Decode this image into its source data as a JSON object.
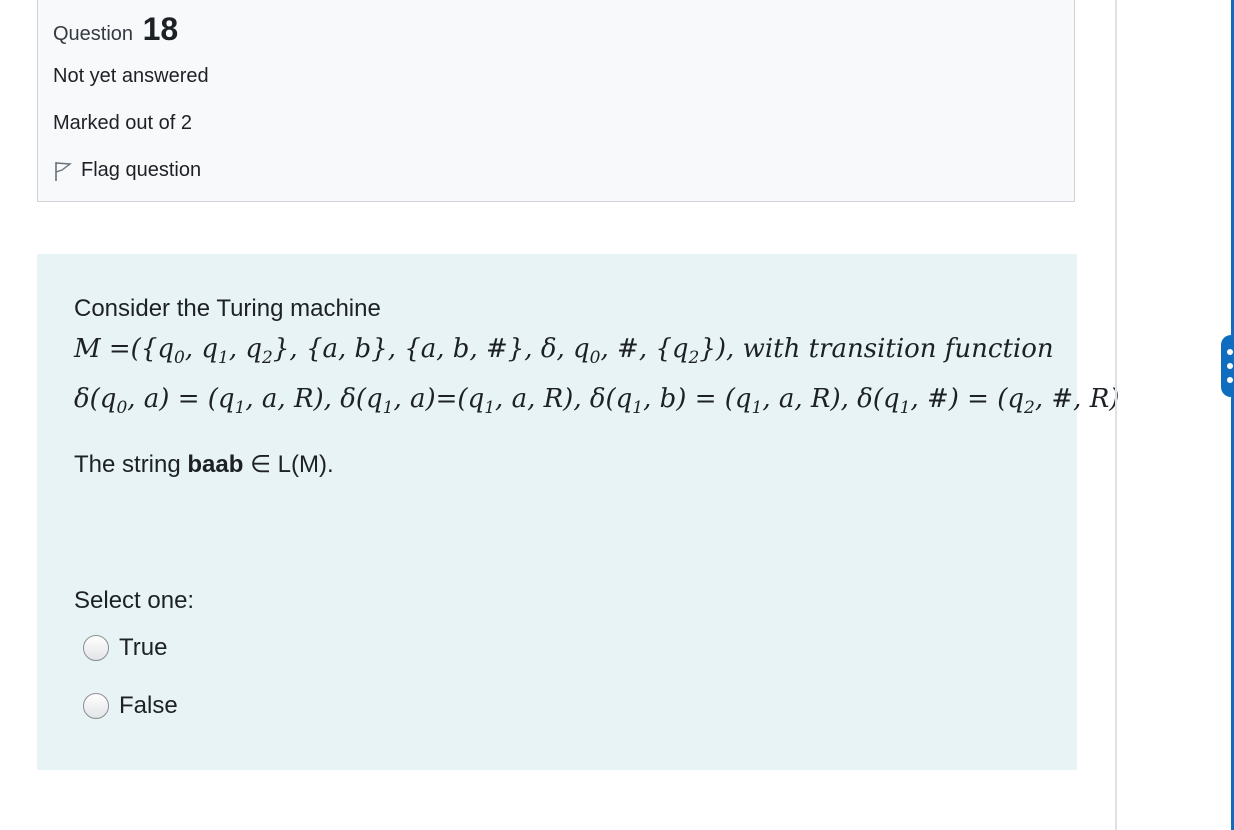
{
  "question_info": {
    "label": "Question",
    "number": "18",
    "state": "Not yet answered",
    "grade": "Marked out of 2",
    "flag_label": "Flag question"
  },
  "question": {
    "intro": "Consider the Turing machine",
    "definition": "M =({q0, q1, q2}, {a, b}, {a, b, #}, δ, q0, #, {q2}), with transition function",
    "transitions": "δ(q0, a) = (q1, a, R), δ(q1, a)=(q1, a, R), δ(q1, b) = (q1, a, R), δ(q1, #) = (q2, #, R)",
    "statement_prefix": "The string",
    "statement_string": "baab",
    "statement_suffix": "∈ L(M).",
    "prompt": "Select one:",
    "options": [
      {
        "label": "True",
        "selected": false
      },
      {
        "label": "False",
        "selected": false
      }
    ]
  },
  "colors": {
    "info_bg": "#f8f9fa",
    "content_bg": "#e7f3f5",
    "accent": "#0f6cbf"
  }
}
